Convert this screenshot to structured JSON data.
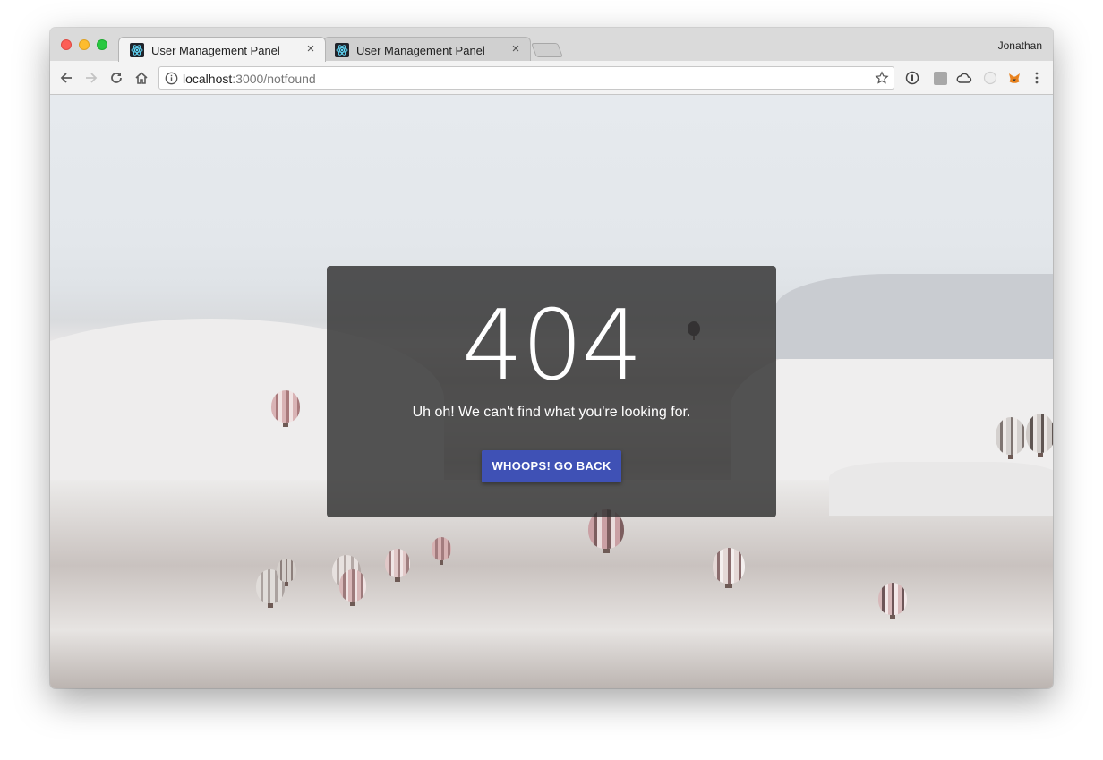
{
  "browser": {
    "tabs": [
      {
        "title": "User Management Panel",
        "close": "×",
        "favicon": "react-atom-icon"
      },
      {
        "title": "User Management Panel",
        "close": "×",
        "favicon": "react-atom-icon"
      }
    ],
    "profile_name": "Jonathan",
    "address": {
      "host": "localhost",
      "path": ":3000/notfound"
    }
  },
  "page": {
    "code": "404",
    "message": "Uh oh! We can't find what you're looking for.",
    "button_label": "WHOOPS! GO BACK",
    "button_color": "#3f51b5"
  }
}
